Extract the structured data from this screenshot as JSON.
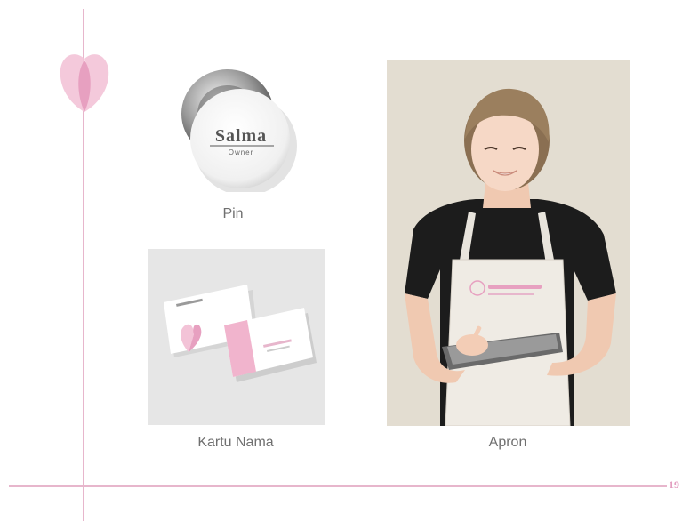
{
  "pin": {
    "name": "Salma",
    "role": "Owner",
    "label": "Pin"
  },
  "card": {
    "label": "Kartu Nama"
  },
  "apron": {
    "label": "Apron"
  },
  "page_number": "19",
  "colors": {
    "accent": "#e7b6cc",
    "petal": "#f0b8cf",
    "text": "#707070",
    "page_number": "#e39ec0"
  }
}
